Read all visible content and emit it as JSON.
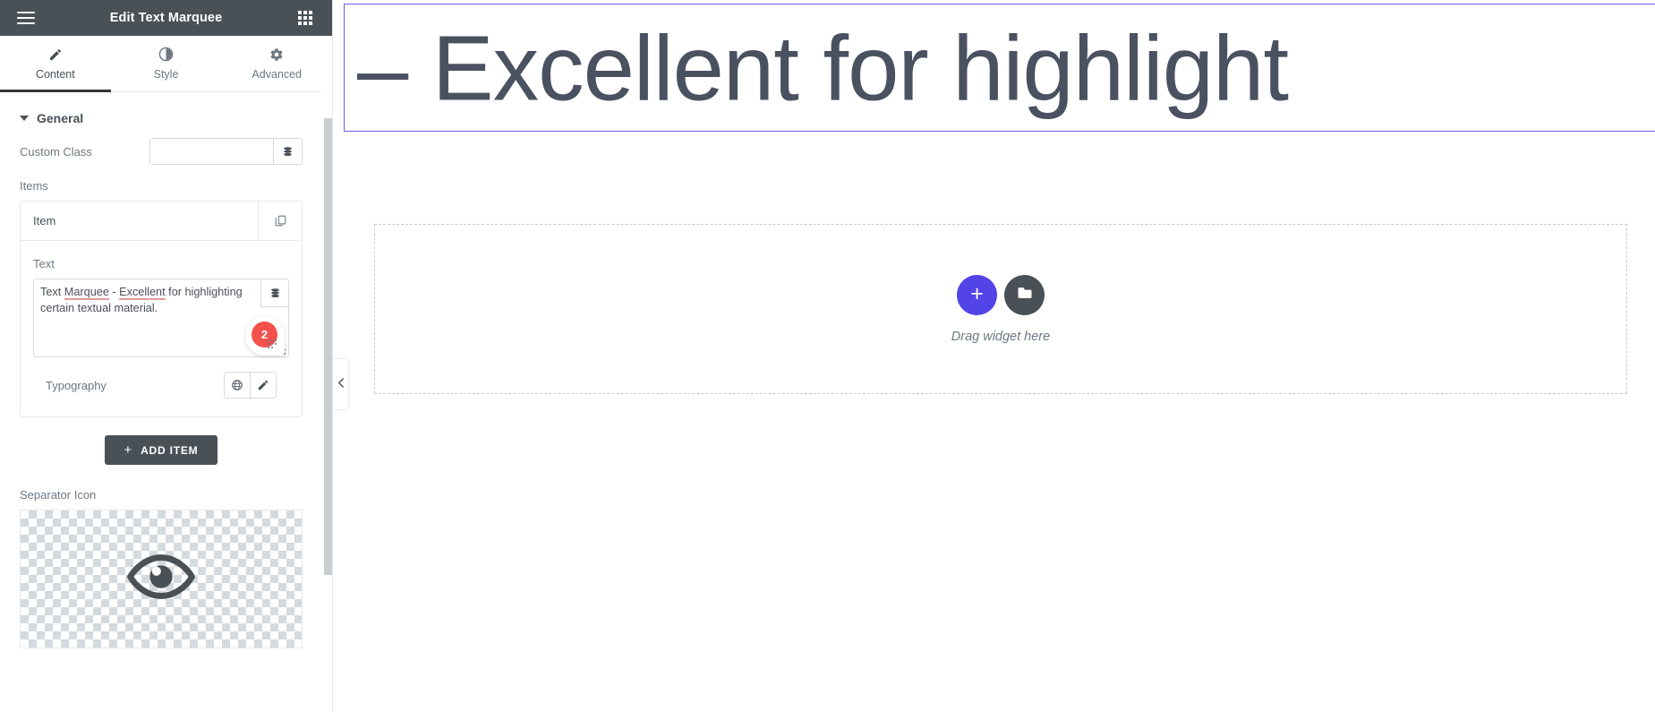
{
  "panel": {
    "header": {
      "title": "Edit Text Marquee",
      "menu_icon": "hamburger-menu-icon",
      "apps_icon": "apps-grid-icon",
      "background": "#495157"
    },
    "tabs": [
      {
        "label": "Content",
        "icon": "pencil-icon",
        "active": true
      },
      {
        "label": "Style",
        "icon": "contrast-half-circle-icon",
        "active": false
      },
      {
        "label": "Advanced",
        "icon": "gear-icon",
        "active": false
      }
    ],
    "sections": {
      "general": {
        "title": "General",
        "custom_class": {
          "label": "Custom Class",
          "value": "",
          "placeholder": "",
          "dynamic_icon": "database-stack-icon"
        },
        "items": {
          "label": "Items",
          "repeater": {
            "item_title": "Item",
            "duplicate_icon": "copy-duplicate-icon",
            "text": {
              "label": "Text",
              "value": "Text Marquee - Excellent for highlighting certain textual material.",
              "spell_errors": [
                "Marquee",
                "Excellent"
              ],
              "dynamic_icon": "database-stack-icon",
              "resize_icon": "resize-handle-icon",
              "badge_count": "2",
              "badge_color": "#f2514c"
            },
            "typography": {
              "label": "Typography",
              "global_icon": "globe-icon",
              "edit_icon": "pencil-edit-icon"
            }
          },
          "add_item_label": "ADD ITEM",
          "add_item_plus": "+"
        },
        "separator_icon": {
          "label": "Separator Icon",
          "icon": "eye-icon",
          "preview_background": "transparency-checkerboard"
        }
      }
    },
    "collapse_icon": "chevron-left-icon",
    "scrollbar": "panel-vertical-scrollbar"
  },
  "canvas": {
    "marquee": {
      "text": "– Excellent for highlight",
      "selection_color": "#6b5ce7",
      "text_color": "#4a5160"
    },
    "dropzone": {
      "add_icon": "plus-icon",
      "folder_icon": "folder-icon",
      "label": "Drag widget here",
      "add_color": "#5344e8",
      "folder_color": "#495157"
    }
  }
}
